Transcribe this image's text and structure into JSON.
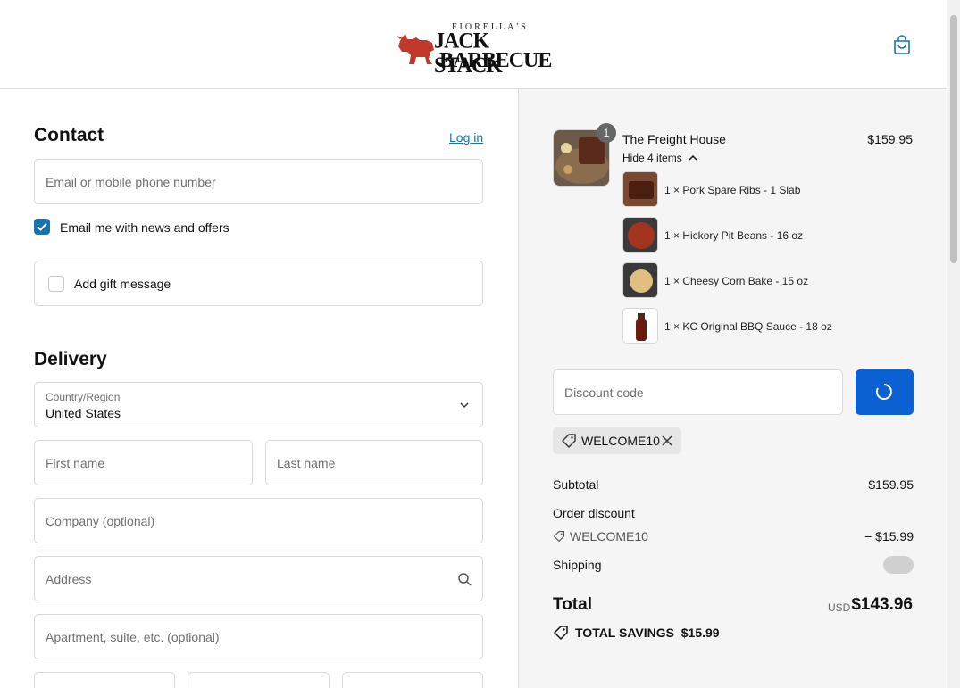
{
  "brand": {
    "pre": "FIORELLA'S",
    "line1": "JACK STACK",
    "line2": "BARBECUE"
  },
  "contact": {
    "title": "Contact",
    "login": "Log in",
    "email_placeholder": "Email or mobile phone number",
    "news_label": "Email me with news and offers",
    "news_checked": true,
    "gift_label": "Add gift message"
  },
  "delivery": {
    "title": "Delivery",
    "country_label": "Country/Region",
    "country_value": "United States",
    "first_name": "First name",
    "last_name": "Last name",
    "company": "Company (optional)",
    "address": "Address",
    "apartment": "Apartment, suite, etc. (optional)"
  },
  "order": {
    "product": {
      "name": "The Freight House",
      "price": "$159.95",
      "qty": "1",
      "toggle": "Hide 4 items"
    },
    "items": [
      {
        "name": "1 × Pork Spare Ribs - 1 Slab"
      },
      {
        "name": "1 × Hickory Pit Beans - 16 oz"
      },
      {
        "name": "1 × Cheesy Corn Bake - 15 oz"
      },
      {
        "name": "1 × KC Original BBQ Sauce - 18 oz"
      }
    ],
    "discount_placeholder": "Discount code",
    "applied_code": "WELCOME10",
    "subtotal_label": "Subtotal",
    "subtotal": "$159.95",
    "order_discount_label": "Order discount",
    "discount_code": "WELCOME10",
    "discount_value": "− $15.99",
    "shipping_label": "Shipping",
    "total_label": "Total",
    "currency": "USD",
    "total": "$143.96",
    "savings_label": "TOTAL SAVINGS",
    "savings_value": "$15.99"
  },
  "colors": {
    "accent": "#1773b0",
    "button": "#0b61d1",
    "logo_red": "#c0392b"
  }
}
